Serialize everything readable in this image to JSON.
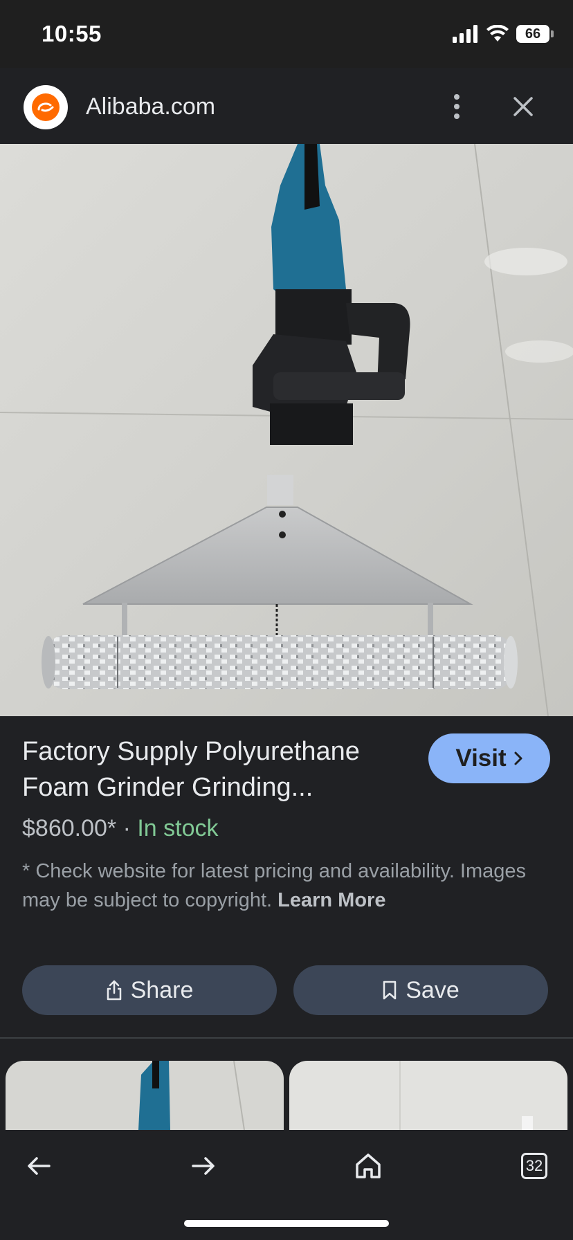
{
  "status_bar": {
    "time": "10:55",
    "battery": "66"
  },
  "header": {
    "site_title": "Alibaba.com"
  },
  "product": {
    "title": "Factory Supply Polyurethane Foam Grinder Grinding...",
    "price": "$860.00*",
    "separator": " · ",
    "stock": "In stock",
    "disclaimer": "* Check website for latest pricing and availability. Images may be subject to copyright.",
    "learn_more": "Learn More"
  },
  "buttons": {
    "visit": "Visit",
    "share": "Share",
    "save": "Save"
  },
  "bottom_nav": {
    "tabs_count": "32"
  },
  "colors": {
    "accent": "#8ab4f8",
    "in_stock": "#81c995",
    "logo": "#ff6a00",
    "chip_bg": "#3c4657"
  }
}
